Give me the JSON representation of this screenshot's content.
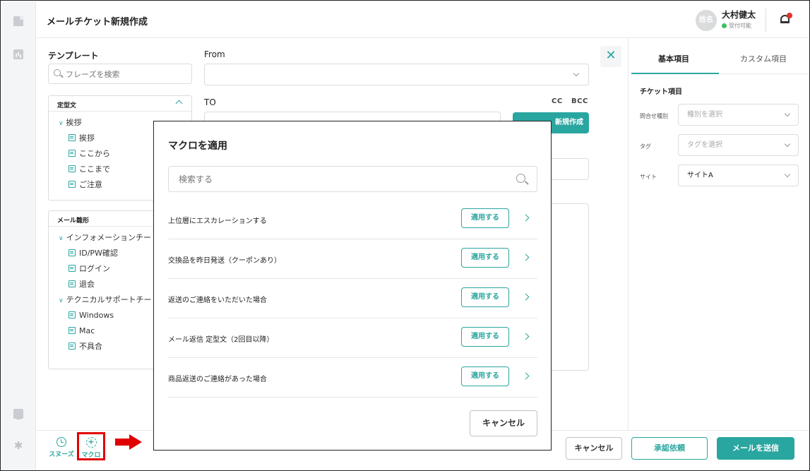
{
  "header": {
    "title": "メールチケット新規作成",
    "avatar_text": "姓名",
    "user_name": "大村健太",
    "user_status": "受付可能"
  },
  "templates": {
    "title": "テンプレート",
    "search_placeholder": "フレーズを検索",
    "fixed": {
      "title": "定型文",
      "group": "挨拶",
      "items": [
        "挨拶",
        "ここから",
        "ここまで",
        "ご注意"
      ]
    },
    "mail": {
      "title": "メール雛形",
      "group1": "インフォメーションチー",
      "group1_items": [
        "ID/PW確認",
        "ログイン",
        "退会"
      ],
      "group2": "テクニカルサポートチー",
      "group2_items": [
        "Windows",
        "Mac",
        "不具合"
      ]
    }
  },
  "compose": {
    "from_label": "From",
    "to_label": "TO",
    "cc": "CC",
    "bcc": "BCC",
    "new_button": "新規作成"
  },
  "right_panel": {
    "tabs": [
      "基本項目",
      "カスタム項目"
    ],
    "section": "チケット項目",
    "fields": [
      {
        "label": "問合せ種別",
        "value": "種別を選択"
      },
      {
        "label": "タグ",
        "value": "タグを選択"
      },
      {
        "label": "サイト",
        "value": "サイトA"
      }
    ]
  },
  "footer": {
    "snooze": "スヌーズ",
    "macro": "マクロ",
    "cancel": "キャンセル",
    "approve": "承認依頼",
    "send": "メールを送信"
  },
  "modal": {
    "title": "マクロを適用",
    "search_placeholder": "検索する",
    "apply_label": "適用する",
    "macros": [
      "上位層にエスカレーションする",
      "交換品を昨日発送（クーポンあり）",
      "返送のご連絡をいただいた場合",
      "メール返信 定型文（2回目以降）",
      "商品返送のご連絡があった場合"
    ],
    "cancel": "キャンセル"
  },
  "colors": {
    "accent": "#2aa6a0",
    "highlight": "#e10000",
    "status_online": "#3dbf62",
    "notification": "#e5322d"
  }
}
